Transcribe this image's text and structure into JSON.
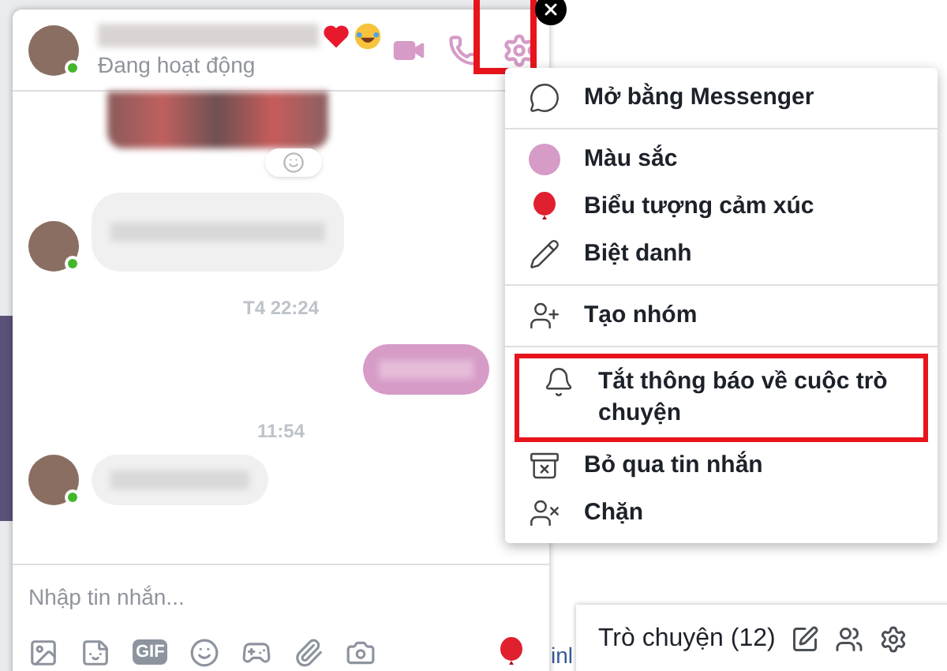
{
  "background_page": {
    "cut_text": "inl"
  },
  "chat": {
    "status": "Đang hoạt động",
    "online": true,
    "settings_highlighted": true,
    "messages": [
      {
        "kind": "image"
      },
      {
        "kind": "incoming"
      },
      {
        "kind": "time",
        "text": "T4 22:24"
      },
      {
        "kind": "outgoing"
      },
      {
        "kind": "time",
        "text": "11:54"
      },
      {
        "kind": "incoming"
      }
    ],
    "input": {
      "placeholder": "Nhập tin nhắn..."
    },
    "gif_label": "GIF"
  },
  "menu": {
    "groups": [
      [
        {
          "kind": "messenger",
          "label": "Mở bằng Messenger",
          "highlighted": false
        }
      ],
      [
        {
          "kind": "color",
          "label": "Màu sắc",
          "highlighted": false,
          "color": "#d69bc7"
        },
        {
          "kind": "emoji",
          "label": "Biểu tượng cảm xúc",
          "highlighted": false
        },
        {
          "kind": "nickname",
          "label": "Biệt danh",
          "highlighted": false
        }
      ],
      [
        {
          "kind": "group",
          "label": "Tạo nhóm",
          "highlighted": false
        }
      ],
      [
        {
          "kind": "mute",
          "label": "Tắt thông báo về cuộc trò chuyện",
          "highlighted": true
        },
        {
          "kind": "ignore",
          "label": "Bỏ qua tin nhắn",
          "highlighted": false
        },
        {
          "kind": "block",
          "label": "Chặn",
          "highlighted": false
        }
      ]
    ]
  },
  "chat_bar": {
    "label": "Trò chuyện (12)"
  }
}
